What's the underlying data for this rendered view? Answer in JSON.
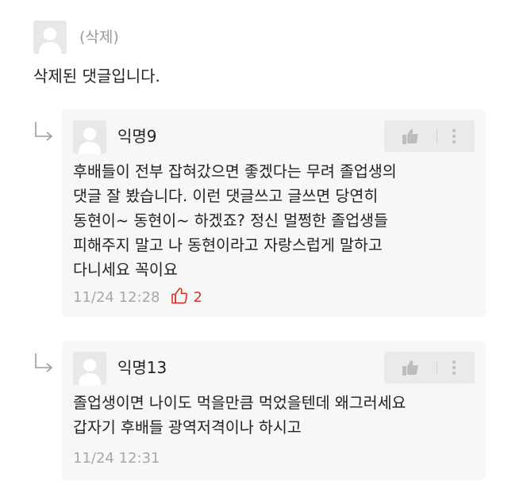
{
  "deleted_comment": {
    "author": "(삭제)",
    "body": "삭제된 댓글입니다."
  },
  "replies": [
    {
      "author": "익명9",
      "body": "후배들이 전부 잡혀갔으면 좋겠다는 무려 졸업생의\n댓글 잘 봤습니다. 이런 댓글쓰고 글쓰면 당연히\n동현이~ 동현이~ 하겠죠? 정신 멀쩡한 졸업생들\n피해주지 말고 나 동현이라고 자랑스럽게 말하고\n다니세요 꼭이요",
      "timestamp": "11/24 12:28",
      "likes": "2"
    },
    {
      "author": "익명13",
      "body": "졸업생이면 나이도 먹을만큼 먹었을텐데 왜그러세요\n갑자기 후배들 광역저격이나 하시고",
      "timestamp": "11/24 12:31"
    }
  ],
  "colors": {
    "like_accent": "#d0352c",
    "card_background": "#f7f7f7",
    "muted_text": "#a8a8a8"
  },
  "icons": {
    "avatar": "default-user-avatar-icon",
    "reply": "reply-arrow-icon",
    "vote": "thumbs-up-icon",
    "more": "vertical-ellipsis-icon",
    "like": "thumbs-up-outline-icon"
  }
}
